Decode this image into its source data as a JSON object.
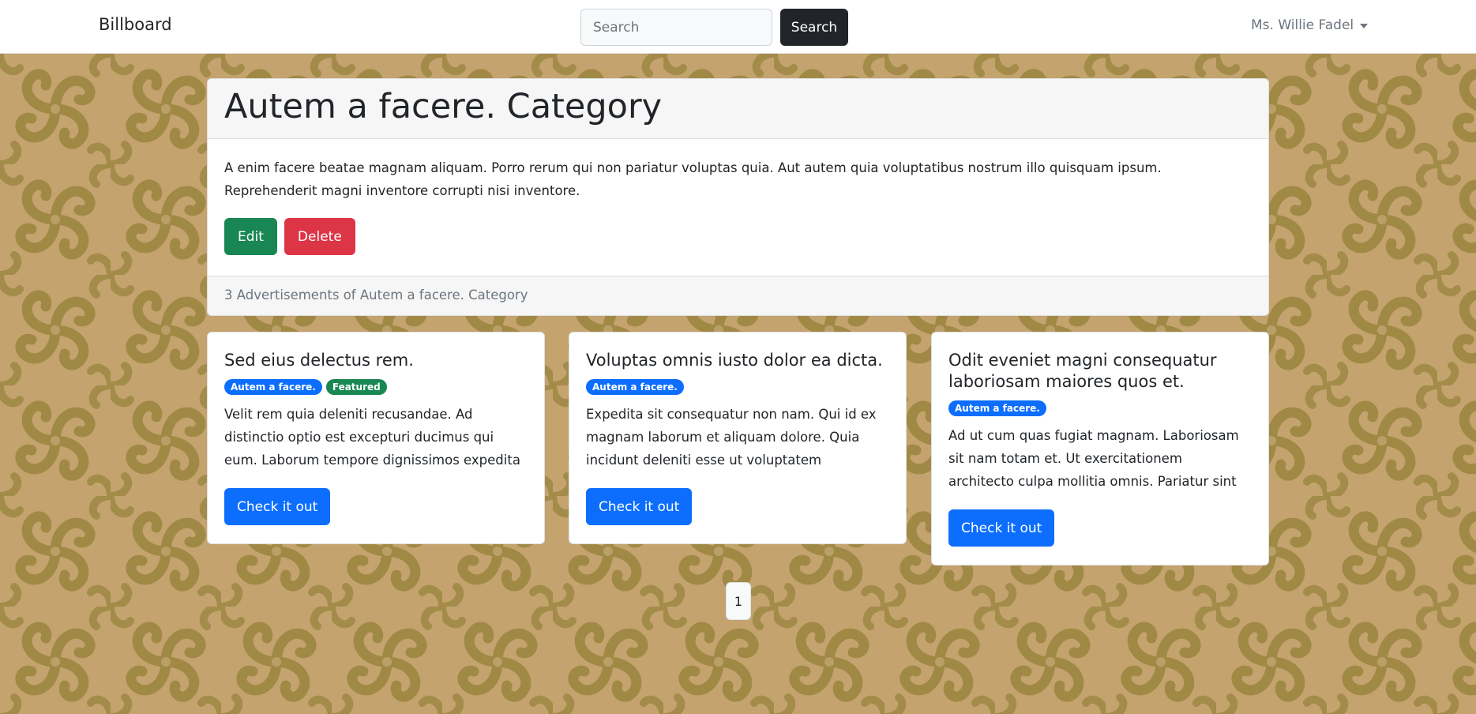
{
  "navbar": {
    "brand": "Billboard",
    "search_placeholder": "Search",
    "search_button": "Search",
    "user_name": "Ms. Willie Fadel"
  },
  "category": {
    "title": "Autem a facere. Category",
    "description": "A enim facere beatae magnam aliquam. Porro rerum qui non pariatur voluptas quia. Aut autem quia voluptatibus nostrum illo quisquam ipsum. Reprehenderit magni inventore corrupti nisi inventore.",
    "edit_label": "Edit",
    "delete_label": "Delete",
    "footer_text": "3 Advertisements of Autem a facere. Category"
  },
  "ads": [
    {
      "title": "Sed eius delectus rem.",
      "badges": [
        "Autem a facere.",
        "Featured"
      ],
      "text": "Velit rem quia deleniti recusandae. Ad distinctio optio est excepturi ducimus qui eum. Laborum tempore dignissimos expedita aut ipsum qua...",
      "button": "Check it out"
    },
    {
      "title": "Voluptas omnis iusto dolor ea dicta.",
      "badges": [
        "Autem a facere."
      ],
      "text": "Expedita sit consequatur non nam. Qui id ex magnam laborum et aliquam dolore. Quia incidunt deleniti esse ut voluptatem assumen...",
      "button": "Check it out"
    },
    {
      "title": "Odit eveniet magni consequatur laboriosam maiores quos et.",
      "badges": [
        "Autem a facere."
      ],
      "text": "Ad ut cum quas fugiat magnam. Laboriosam sit nam totam et. Ut exercitationem architecto culpa mollitia omnis. Pariatur sint cupiditate...",
      "button": "Check it out"
    }
  ],
  "pagination": {
    "current_page": "1"
  },
  "colors": {
    "background": "#c4a36e",
    "pattern": "#a08945",
    "primary": "#0d6efd",
    "success": "#198754",
    "danger": "#dc3545",
    "dark": "#212529"
  }
}
